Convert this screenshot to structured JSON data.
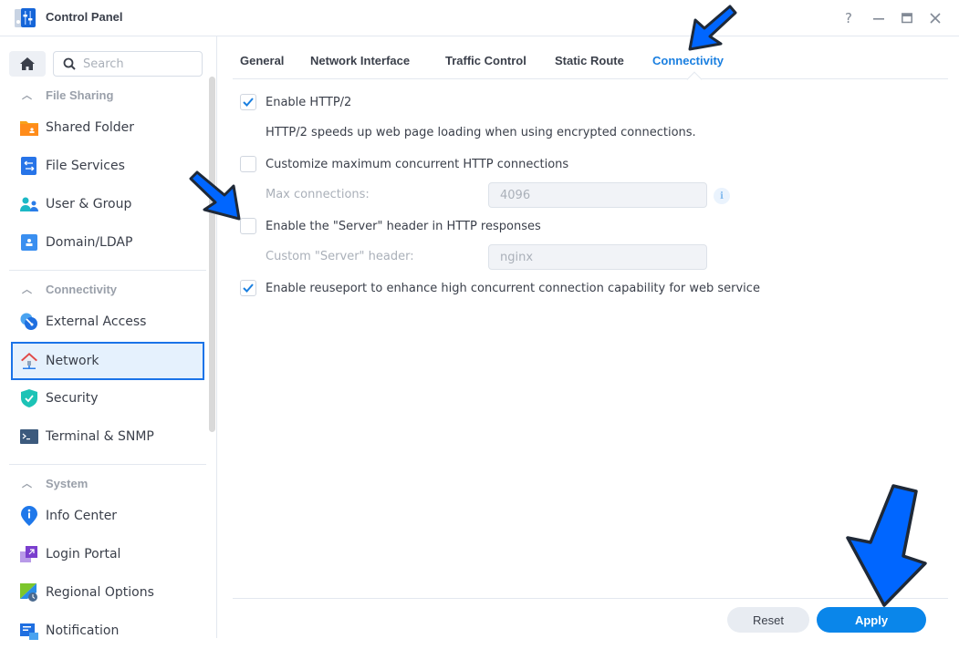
{
  "window": {
    "title": "Control Panel",
    "controls": {
      "help": "?",
      "minimize": "–",
      "maximize": "□",
      "close": "✕"
    }
  },
  "sidebar": {
    "search_placeholder": "Search",
    "sections": [
      {
        "title": "File Sharing",
        "items": [
          {
            "label": "Shared Folder",
            "icon": "shared-folder-icon"
          },
          {
            "label": "File Services",
            "icon": "file-services-icon"
          },
          {
            "label": "User & Group",
            "icon": "user-group-icon"
          },
          {
            "label": "Domain/LDAP",
            "icon": "domain-ldap-icon"
          }
        ]
      },
      {
        "title": "Connectivity",
        "items": [
          {
            "label": "External Access",
            "icon": "external-access-icon"
          },
          {
            "label": "Network",
            "icon": "network-icon",
            "active": true
          },
          {
            "label": "Security",
            "icon": "security-shield-icon"
          },
          {
            "label": "Terminal & SNMP",
            "icon": "terminal-icon"
          }
        ]
      },
      {
        "title": "System",
        "items": [
          {
            "label": "Info Center",
            "icon": "info-center-icon"
          },
          {
            "label": "Login Portal",
            "icon": "login-portal-icon"
          },
          {
            "label": "Regional Options",
            "icon": "regional-options-icon"
          },
          {
            "label": "Notification",
            "icon": "notification-icon"
          }
        ]
      }
    ]
  },
  "tabs": [
    {
      "label": "General"
    },
    {
      "label": "Network Interface"
    },
    {
      "label": "Traffic Control"
    },
    {
      "label": "Static Route"
    },
    {
      "label": "Connectivity",
      "active": true
    }
  ],
  "content": {
    "http2": {
      "label": "Enable HTTP/2",
      "checked": true,
      "description": "HTTP/2 speeds up web page loading when using encrypted connections."
    },
    "max_conn": {
      "label": "Customize maximum concurrent HTTP connections",
      "checked": false,
      "field_label": "Max connections:",
      "field_value": "4096"
    },
    "server_header": {
      "label": "Enable the \"Server\" header in HTTP responses",
      "checked": false,
      "field_label": "Custom \"Server\" header:",
      "field_value": "nginx"
    },
    "reuseport": {
      "label": "Enable reuseport to enhance high concurrent connection capability for web service",
      "checked": true
    }
  },
  "footer": {
    "reset_label": "Reset",
    "apply_label": "Apply"
  },
  "colors": {
    "accent": "#1a7fe0",
    "apply": "#0a86ea",
    "annotation_arrow": "#0066ff"
  }
}
